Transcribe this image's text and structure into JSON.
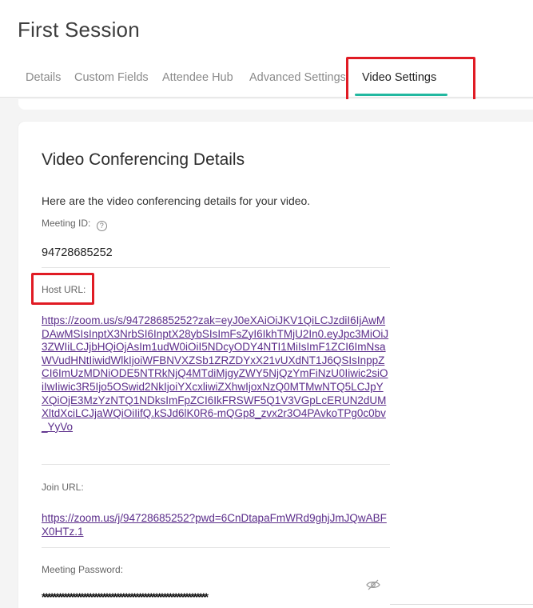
{
  "page": {
    "title": "First Session"
  },
  "tabs": [
    {
      "label": "Details",
      "active": false
    },
    {
      "label": "Custom Fields",
      "active": false
    },
    {
      "label": "Attendee Hub",
      "active": false
    },
    {
      "label": "Advanced Settings",
      "active": false
    },
    {
      "label": "Video Settings",
      "active": true
    }
  ],
  "colors": {
    "accent": "#22b8a0",
    "highlight": "#e01b24",
    "link": "#5b2d8a"
  },
  "card": {
    "title": "Video Conferencing Details",
    "intro": "Here are the video conferencing details for your video.",
    "meeting_id": {
      "label": "Meeting ID:",
      "help_icon": "help-circle-icon",
      "value": "94728685252"
    },
    "host_url": {
      "label": "Host URL:",
      "value": "https://zoom.us/s/94728685252?zak=eyJ0eXAiOiJKV1QiLCJzdiI6IjAwMDAwMSIsInptX3NrbSI6InptX28ybSIsImFsZyI6IkhTMjU2In0.eyJpc3MiOiJ3ZWIiLCJjbHQiOjAsIm1udW0iOiI5NDcyODY4NTI1MiIsImF1ZCI6ImNsaWVudHNtIiwidWlkIjoiWFBNVXZSb1ZRZDYxX21vUXdNT1J6QSIsInppZCI6ImUzMDNiODE5NTRkNjQ4MTdiMjgyZWY5NjQzYmFiNzU0Iiwic2siOiIwIiwic3R5Ijo5OSwid2NkIjoiYXcxliwiZXhwIjoxNzQ0MTMwNTQ5LCJpYXQiOjE3MzYzNTQ1NDksImFpZCI6IkFRSWF5Q1V3VGpLcERUN2dUMXltdXciLCJjaWQiOiIifQ.kSJd6lK0R6-mQGp8_zvx2r3O4PAvkoTPg0c0bv_YyVo"
    },
    "join_url": {
      "label": "Join URL:",
      "value": "https://zoom.us/j/94728685252?pwd=6CnDtapaFmWRd9ghjJmJQwABFX0HTz.1"
    },
    "meeting_password": {
      "label": "Meeting Password:",
      "masked_value": "************************************************************",
      "toggle_icon": "eye-slash-icon"
    }
  }
}
